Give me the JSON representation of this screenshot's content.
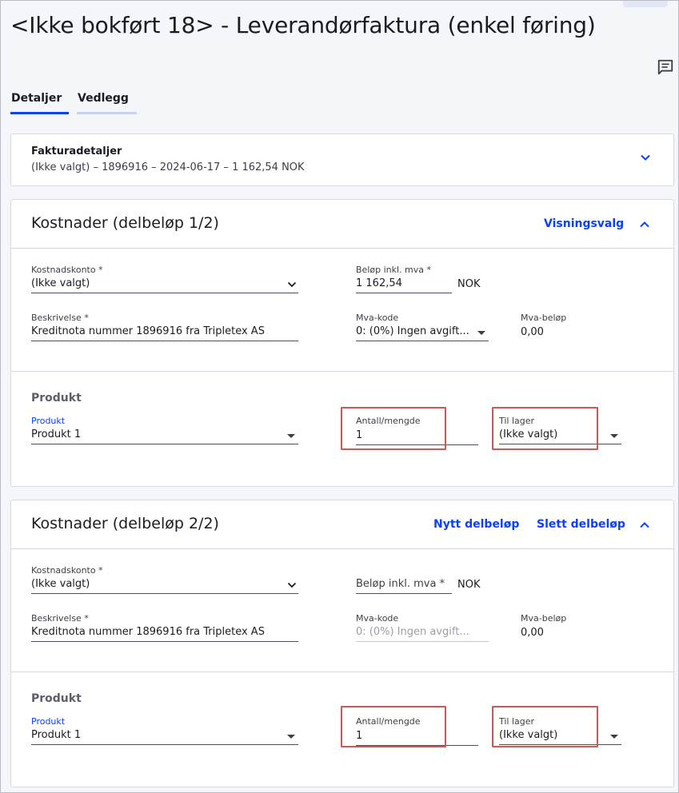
{
  "page": {
    "title": "<Ikke bokført 18> - Leverandørfaktura (enkel føring)"
  },
  "tabs": [
    {
      "label": "Detaljer"
    },
    {
      "label": "Vedlegg"
    }
  ],
  "invoice": {
    "title": "Fakturadetaljer",
    "summary": "(Ikke valgt) – 1896916 – 2024-06-17 – 1 162,54 NOK"
  },
  "cost1": {
    "title": "Kostnader (delbeløp 1/2)",
    "link_view": "Visningsvalg",
    "account_label": "Kostnadskonto *",
    "account_value": "(Ikke valgt)",
    "amount_label": "Beløp inkl. mva *",
    "amount_value": "1 162,54",
    "currency": "NOK",
    "desc_label": "Beskrivelse *",
    "desc_value": "Kreditnota nummer 1896916 fra Tripletex AS",
    "vat_label": "Mva-kode",
    "vat_value": "0: (0%) Ingen avgift...",
    "vat_amount_label": "Mva-beløp",
    "vat_amount_value": "0,00",
    "product_section": "Produkt",
    "product_label": "Produkt",
    "product_value": "Produkt 1",
    "qty_label": "Antall/mengde",
    "qty_value": "1",
    "stock_label": "Til lager",
    "stock_value": "(Ikke valgt)"
  },
  "cost2": {
    "title": "Kostnader (delbeløp 2/2)",
    "link_new": "Nytt delbeløp",
    "link_delete": "Slett delbeløp",
    "account_label": "Kostnadskonto *",
    "account_value": "(Ikke valgt)",
    "amount_placeholder": "Beløp inkl. mva *",
    "currency": "NOK",
    "desc_label": "Beskrivelse *",
    "desc_value": "Kreditnota nummer 1896916 fra Tripletex AS",
    "vat_label": "Mva-kode",
    "vat_value": "0: (0%) Ingen avgift...",
    "vat_amount_label": "Mva-beløp",
    "vat_amount_value": "0,00",
    "product_section": "Produkt",
    "product_label": "Produkt",
    "product_value": "Produkt 1",
    "qty_label": "Antall/mengde",
    "qty_value": "1",
    "stock_label": "Til lager",
    "stock_value": "(Ikke valgt)"
  },
  "colors": {
    "accent": "#0a41fa",
    "highlight": "#d9534f"
  },
  "icons": {
    "comment": "comment-icon",
    "chevron_down": "chevron-down-icon",
    "chevron_up": "chevron-up-icon"
  }
}
